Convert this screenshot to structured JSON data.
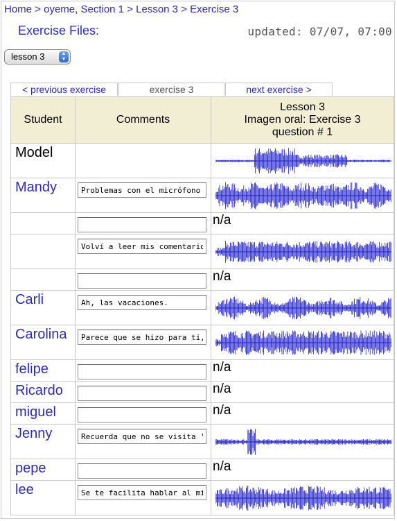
{
  "breadcrumb": {
    "items": [
      "Home",
      "oyeme, Section 1",
      "Lesson 3",
      "Exercise 3"
    ],
    "separator": ">"
  },
  "heading": "Exercise Files:",
  "updated": "updated: 07/07, 07:00",
  "lesson_select": {
    "selected": "lesson 3"
  },
  "nav": {
    "prev": "< previous exercise",
    "current": "exercise 3",
    "next": "next exercise >"
  },
  "table": {
    "headers": {
      "student": "Student",
      "comments": "Comments",
      "recording_line1": "Lesson 3",
      "recording_line2": "Imagen oral: Exercise 3",
      "recording_line3": "question # 1"
    },
    "rows": [
      {
        "student": "Model",
        "comment": "",
        "has_comment_box": false,
        "recording": "wave",
        "na": ""
      },
      {
        "student": "Mandy",
        "comment": "Problemas con el micrófono",
        "has_comment_box": true,
        "recording": "wave",
        "na": ""
      },
      {
        "student": "",
        "comment": "",
        "has_comment_box": true,
        "recording": "none",
        "na": "n/a"
      },
      {
        "student": "",
        "comment": "Volví a leer mis comentarios",
        "has_comment_box": true,
        "recording": "wave",
        "na": ""
      },
      {
        "student": "",
        "comment": "",
        "has_comment_box": true,
        "recording": "none",
        "na": "n/a"
      },
      {
        "student": "Carli",
        "comment": "Ah, las vacaciones.",
        "has_comment_box": true,
        "recording": "wave",
        "na": ""
      },
      {
        "student": "Carolina",
        "comment": "Parece que se hizo para ti,",
        "has_comment_box": true,
        "recording": "wave",
        "na": ""
      },
      {
        "student": "felipe",
        "comment": "",
        "has_comment_box": true,
        "recording": "none",
        "na": "n/a"
      },
      {
        "student": "Ricardo",
        "comment": "",
        "has_comment_box": true,
        "recording": "none",
        "na": "n/a"
      },
      {
        "student": "miguel",
        "comment": "",
        "has_comment_box": true,
        "recording": "none",
        "na": "n/a"
      },
      {
        "student": "Jenny",
        "comment": "Recuerda que no se visita '",
        "has_comment_box": true,
        "recording": "wave",
        "na": ""
      },
      {
        "student": "pepe",
        "comment": "",
        "has_comment_box": true,
        "recording": "none",
        "na": "n/a"
      },
      {
        "student": "lee",
        "comment": "Se te facilita hablar al mira",
        "has_comment_box": true,
        "recording": "wave",
        "na": ""
      }
    ]
  },
  "colors": {
    "link": "#2b2bb8",
    "header_bg": "#f1eed3",
    "waveform": "#1d1dcc"
  }
}
